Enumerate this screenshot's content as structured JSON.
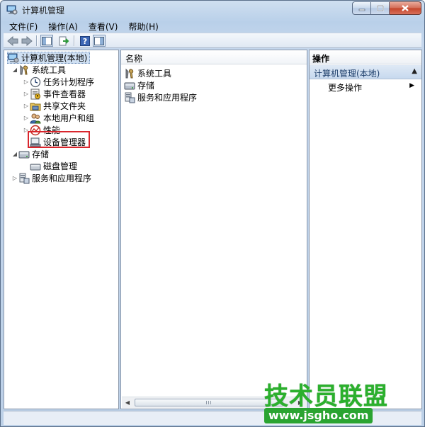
{
  "window": {
    "title": "计算机管理"
  },
  "menu": [
    "文件(F)",
    "操作(A)",
    "查看(V)",
    "帮助(H)"
  ],
  "tree": {
    "root": "计算机管理(本地)",
    "system_tools": "系统工具",
    "task_scheduler": "任务计划程序",
    "event_viewer": "事件查看器",
    "shared_folders": "共享文件夹",
    "local_users": "本地用户和组",
    "performance": "性能",
    "device_manager": "设备管理器",
    "storage": "存储",
    "disk_management": "磁盘管理",
    "services_apps": "服务和应用程序"
  },
  "content": {
    "column_header": "名称",
    "items": [
      "系统工具",
      "存储",
      "服务和应用程序"
    ],
    "scroll_thumb": "III"
  },
  "actions": {
    "header": "操作",
    "group": "计算机管理(本地)",
    "more": "更多操作"
  },
  "watermark": {
    "title": "技术员联盟",
    "url": "www.jsgho.com"
  },
  "colors": {
    "highlight": "#d9262d",
    "watermark": "#2bb02d",
    "selection": "#cfe0f3"
  }
}
